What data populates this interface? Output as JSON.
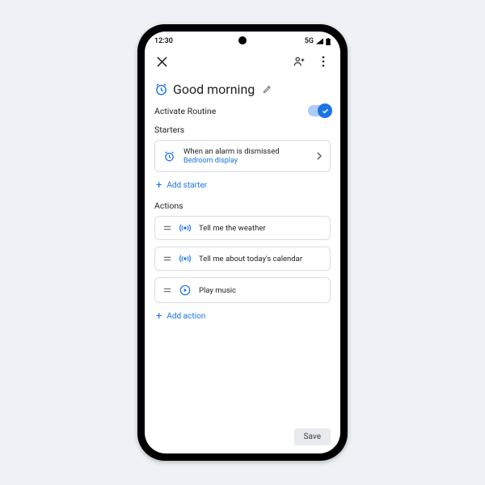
{
  "status": {
    "time": "12:30",
    "network": "5G"
  },
  "title": "Good morning",
  "activate_label": "Activate Routine",
  "activate_on": true,
  "sections": {
    "starters": {
      "heading": "Starters",
      "items": [
        {
          "icon": "alarm-icon",
          "line1": "When an alarm is dismissed",
          "line2": "Bedroom display"
        }
      ],
      "add_label": "Add starter"
    },
    "actions": {
      "heading": "Actions",
      "items": [
        {
          "icon": "broadcast-icon",
          "label": "Tell me the weather"
        },
        {
          "icon": "broadcast-icon",
          "label": "Tell me about today's calendar"
        },
        {
          "icon": "play-icon",
          "label": "Play music"
        }
      ],
      "add_label": "Add action"
    }
  },
  "footer": {
    "save": "Save"
  },
  "colors": {
    "accent": "#1a73e8"
  }
}
